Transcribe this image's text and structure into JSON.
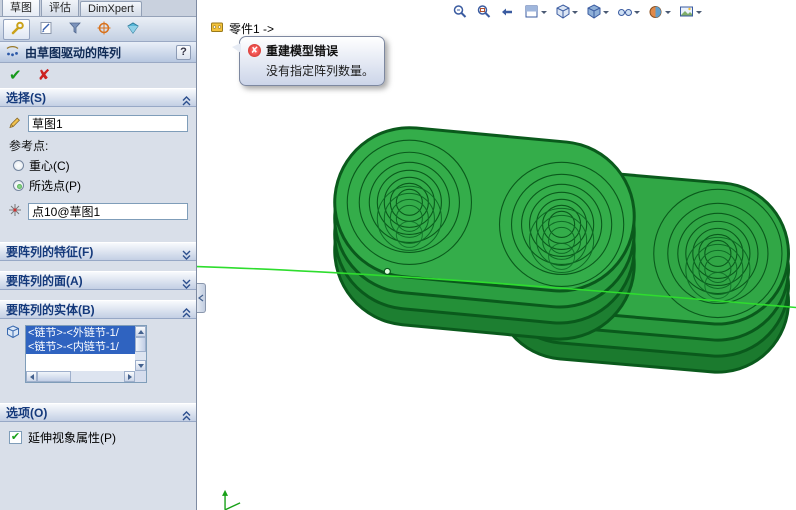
{
  "ribbon_tabs": {
    "sketch": "草图",
    "evaluate": "评估",
    "dimxpert": "DimXpert"
  },
  "panel": {
    "title": "由草图驱动的阵列",
    "help": "?",
    "ok": "✔",
    "cancel": "✘",
    "selection": {
      "header": "选择(S)",
      "sketch_value": "草图1",
      "reference_label": "参考点:",
      "centroid": "重心(C)",
      "selected_point": "所选点(P)",
      "point_value": "点10@草图1"
    },
    "features_header": "要阵列的特征(F)",
    "faces_header": "要阵列的面(A)",
    "bodies_header": "要阵列的实体(B)",
    "bodies_items": [
      "<链节>-<外链节-1/",
      "<链节>-<内链节-1/"
    ],
    "options_header": "选项(O)",
    "propagate_label": "延伸视象属性(P)"
  },
  "viewport": {
    "part_label": "零件1 ->",
    "error_title": "重建模型错误",
    "error_message": "没有指定阵列数量。"
  },
  "colors": {
    "model_green": "#34ad4a",
    "selection_blue": "#2f63c0",
    "header_text": "#14397b"
  }
}
